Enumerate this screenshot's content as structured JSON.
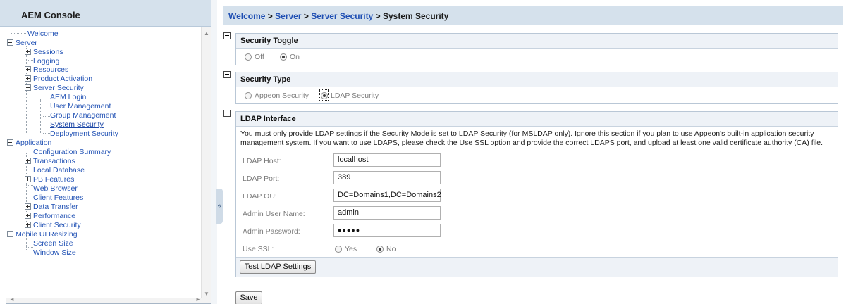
{
  "sidebar": {
    "title": "AEM Console",
    "tree": [
      {
        "label": "Welcome"
      },
      {
        "label": "Server"
      },
      {
        "label": "Sessions"
      },
      {
        "label": "Logging"
      },
      {
        "label": "Resources"
      },
      {
        "label": "Product Activation"
      },
      {
        "label": "Server Security"
      },
      {
        "label": "AEM Login"
      },
      {
        "label": "User Management"
      },
      {
        "label": "Group Management"
      },
      {
        "label": "System Security"
      },
      {
        "label": "Deployment Security"
      },
      {
        "label": "Application"
      },
      {
        "label": "Configuration Summary"
      },
      {
        "label": "Transactions"
      },
      {
        "label": "Local Database"
      },
      {
        "label": "PB Features"
      },
      {
        "label": "Web Browser"
      },
      {
        "label": "Client Features"
      },
      {
        "label": "Data Transfer"
      },
      {
        "label": "Performance"
      },
      {
        "label": "Client Security"
      },
      {
        "label": "Mobile UI Resizing"
      },
      {
        "label": "Screen Size"
      },
      {
        "label": "Window Size"
      }
    ],
    "collapse_glyph": "«",
    "scroll_up_glyph": "▲",
    "scroll_down_glyph": "▼",
    "scroll_left_glyph": "◄",
    "scroll_right_glyph": "►"
  },
  "breadcrumb": {
    "welcome": "Welcome",
    "sep1": " > ",
    "server": "Server",
    "sep2": " > ",
    "server_security": "Server Security",
    "sep3": " > ",
    "current": "System Security"
  },
  "security_toggle": {
    "title": "Security Toggle",
    "off_label": "Off",
    "on_label": "On",
    "selected": "On"
  },
  "security_type": {
    "title": "Security Type",
    "appeon_label": "Appeon Security",
    "ldap_label": "LDAP Security",
    "selected": "LDAP Security"
  },
  "ldap": {
    "title": "LDAP Interface",
    "description": "You must only provide LDAP settings if the Security Mode is set to LDAP Security (for MSLDAP only). Ignore this section if you plan to use Appeon's built-in application security management system. If you want to use LDAPS, please check the Use SSL option and provide the correct LDAPS port, and upload at least one valid certificate authority (CA) file.",
    "host_label": "LDAP Host:",
    "host_value": "localhost",
    "port_label": "LDAP Port:",
    "port_value": "389",
    "ou_label": "LDAP OU:",
    "ou_value": "DC=Domains1,DC=Domains2",
    "admin_user_label": "Admin User Name:",
    "admin_user_value": "admin",
    "admin_pass_label": "Admin Password:",
    "admin_pass_value": "●●●●●",
    "ssl_label": "Use SSL:",
    "ssl_yes": "Yes",
    "ssl_no": "No",
    "ssl_selected": "No",
    "test_button": "Test LDAP Settings"
  },
  "save_button": "Save"
}
